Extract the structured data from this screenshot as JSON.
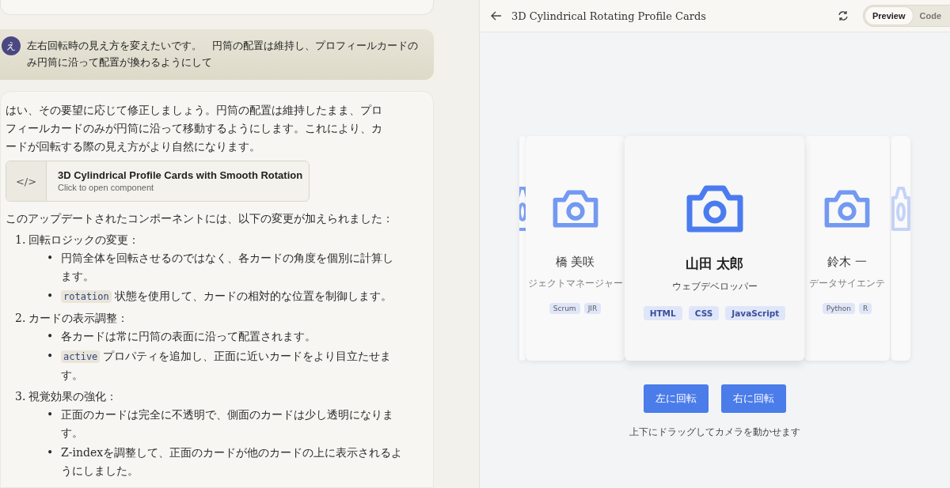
{
  "user_message": {
    "avatar": "え",
    "text": "左右回転時の見え方を変えたいです。　円筒の配置は維持し、プロフィールカードのみ円筒に沿って配置が換わるようにして"
  },
  "reply": {
    "intro": "はい、その要望に応じて修正しましょう。円筒の配置は維持したまま、プロフィールカードのみが円筒に沿って移動するようにします。これにより、カードが回転する際の見え方がより自然になります。",
    "artifact": {
      "icon": "</>",
      "title": "3D Cylindrical Profile Cards with Smooth Rotation",
      "subtitle": "Click to open component"
    },
    "lead": "このアップデートされたコンポーネントには、以下の変更が加えられました：",
    "sections": [
      {
        "number": "1.",
        "title": "回転ロジックの変更：",
        "bullets": [
          {
            "marker": "•",
            "text": "円筒全体を回転させるのではなく、各カードの角度を個別に計算します。"
          },
          {
            "marker": "•",
            "code": "rotation",
            "text": "状態を使用して、カードの相対的な位置を制御します。"
          }
        ]
      },
      {
        "number": "2.",
        "title": "カードの表示調整：",
        "bullets": [
          {
            "marker": "•",
            "text": "各カードは常に円筒の表面に沿って配置されます。"
          },
          {
            "marker": "•",
            "code": "active",
            "text": "プロパティを追加し、正面に近いカードをより目立たせます。"
          }
        ]
      },
      {
        "number": "3.",
        "title": "視覚効果の強化：",
        "bullets": [
          {
            "marker": "•",
            "text": "正面のカードは完全に不透明で、側面のカードは少し透明になります。"
          },
          {
            "marker": "•",
            "text": "Z-indexを調整して、正面のカードが他のカードの上に表示されるようにしました。"
          }
        ]
      }
    ]
  },
  "preview": {
    "title": "3D Cylindrical Rotating Profile Cards",
    "tabs": [
      {
        "label": "Preview",
        "selected": true
      },
      {
        "label": "Code",
        "selected": false
      }
    ],
    "cards": [
      {
        "kind": "far"
      },
      {
        "kind": "side",
        "name": "橋 美咲",
        "role": "ジェクトマネージャー",
        "tags": [
          "Scrum",
          "JIR"
        ]
      },
      {
        "kind": "front",
        "name": "山田 太郎",
        "role": "ウェブデベロッパー",
        "tags": [
          "HTML",
          "CSS",
          "JavaScript"
        ]
      },
      {
        "kind": "side",
        "name": "鈴木 一",
        "role": "データサイエンテ",
        "tags": [
          "Python",
          "R"
        ]
      },
      {
        "kind": "far"
      }
    ],
    "buttons": [
      "左に回転",
      "右に回転"
    ],
    "hint": "上下にドラッグしてカメラを動かせます"
  }
}
